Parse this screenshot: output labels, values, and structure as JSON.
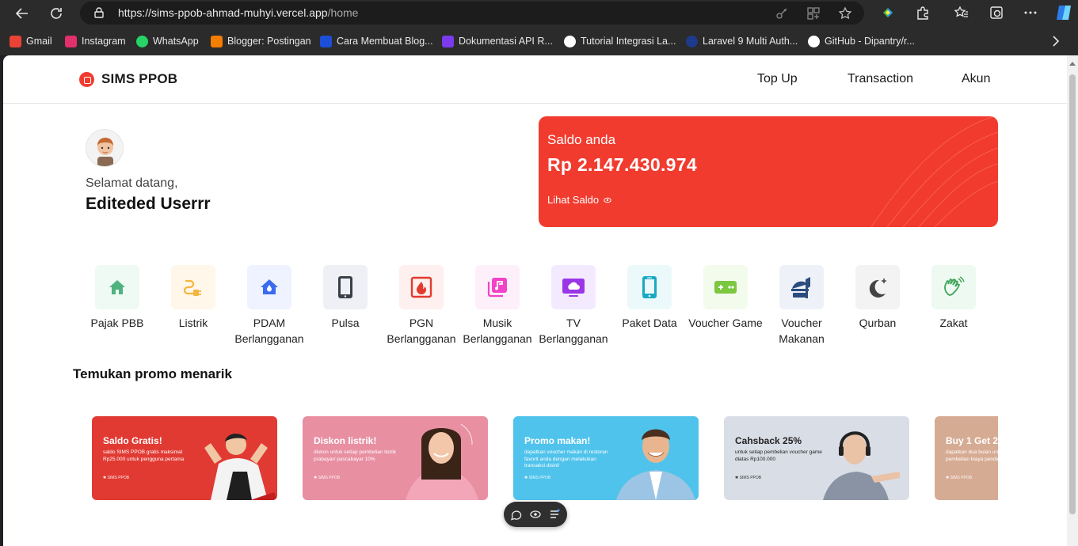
{
  "browser": {
    "url_host": "https://sims-ppob-ahmad-muhyi.vercel.app",
    "url_path": "/home",
    "bookmarks": [
      {
        "label": "Gmail",
        "color": "#ea4335"
      },
      {
        "label": "Instagram",
        "color": "#e1306c"
      },
      {
        "label": "WhatsApp",
        "color": "#25d366"
      },
      {
        "label": "Blogger: Postingan",
        "color": "#f57d00"
      },
      {
        "label": "Cara Membuat Blog...",
        "color": "#1d4ed8"
      },
      {
        "label": "Dokumentasi API R...",
        "color": "#7c3aed"
      },
      {
        "label": "Tutorial Integrasi La...",
        "color": "#ffffff"
      },
      {
        "label": "Laravel 9 Multi Auth...",
        "color": "#1e3a8a"
      },
      {
        "label": "GitHub - Dipantry/r...",
        "color": "#ffffff"
      }
    ]
  },
  "header": {
    "brand": "SIMS PPOB",
    "nav": [
      "Top Up",
      "Transaction",
      "Akun"
    ]
  },
  "user": {
    "greeting": "Selamat datang,",
    "name": "Editeded Userrr"
  },
  "balance": {
    "label": "Saldo anda",
    "amount": "Rp 2.147.430.974",
    "toggle_label": "Lihat Saldo"
  },
  "services": [
    {
      "name": "Pajak PBB",
      "icon": "house-icon",
      "bg": "#eefaf3",
      "color": "#4fb27f"
    },
    {
      "name": "Listrik",
      "icon": "plug-icon",
      "bg": "#fff7e9",
      "color": "#f5b53d"
    },
    {
      "name": "PDAM Berlangganan",
      "icon": "water-home-icon",
      "bg": "#eef3ff",
      "color": "#3b6cf0"
    },
    {
      "name": "Pulsa",
      "icon": "phone-icon",
      "bg": "#eef0f5",
      "color": "#3a3f4a"
    },
    {
      "name": "PGN Berlangganan",
      "icon": "gas-flame-icon",
      "bg": "#fdf0ef",
      "color": "#e23b2e"
    },
    {
      "name": "Musik Berlangganan",
      "icon": "music-icon",
      "bg": "#fdf0fa",
      "color": "#f043c8"
    },
    {
      "name": "TV Berlangganan",
      "icon": "tv-icon",
      "bg": "#f3eaff",
      "color": "#9b36e6"
    },
    {
      "name": "Paket Data",
      "icon": "mobile-data-icon",
      "bg": "#ecf9fb",
      "color": "#1aa9c2"
    },
    {
      "name": "Voucher Game",
      "icon": "gamepad-icon",
      "bg": "#f3fbec",
      "color": "#7cc740"
    },
    {
      "name": "Voucher Makanan",
      "icon": "food-icon",
      "bg": "#eef2f8",
      "color": "#2a4d7e"
    },
    {
      "name": "Qurban",
      "icon": "moon-star-icon",
      "bg": "#f3f3f3",
      "color": "#444444"
    },
    {
      "name": "Zakat",
      "icon": "hands-icon",
      "bg": "#eefaf1",
      "color": "#3fa35a"
    }
  ],
  "promo_section_title": "Temukan promo menarik",
  "promos": [
    {
      "title": "Saldo Gratis!",
      "desc": "saldo SIMS PPOB gratis maksimal Rp25.000 untuk pengguna pertama",
      "brand": "SIMS PPOB",
      "bg": "#e13a33",
      "dark": false
    },
    {
      "title": "Diskon listrik!",
      "desc": "diskon untuk setiap pembelian listrik prabayar/ pascabayar 10%",
      "brand": "SIMS PPOB",
      "bg": "#e88fa2",
      "dark": false
    },
    {
      "title": "Promo makan!",
      "desc": "dapatkan voucher makan di restoran favorit anda dengan melakukan transaksi disini!",
      "brand": "SIMS PPOB",
      "bg": "#4fc3ec",
      "dark": false
    },
    {
      "title": "Cahsback 25%",
      "desc": "untuk setiap pembelian voucher game diatas Rp100.000",
      "brand": "SIMS PPOB",
      "bg": "#d9dde6",
      "dark": true
    },
    {
      "title": "Buy 1 Get 2",
      "desc": "dapatkan dua bulan untuk setiap pembelian biaya pendidikan sa",
      "brand": "SIMS PPOB",
      "bg": "#d6ab93",
      "dark": false
    }
  ]
}
